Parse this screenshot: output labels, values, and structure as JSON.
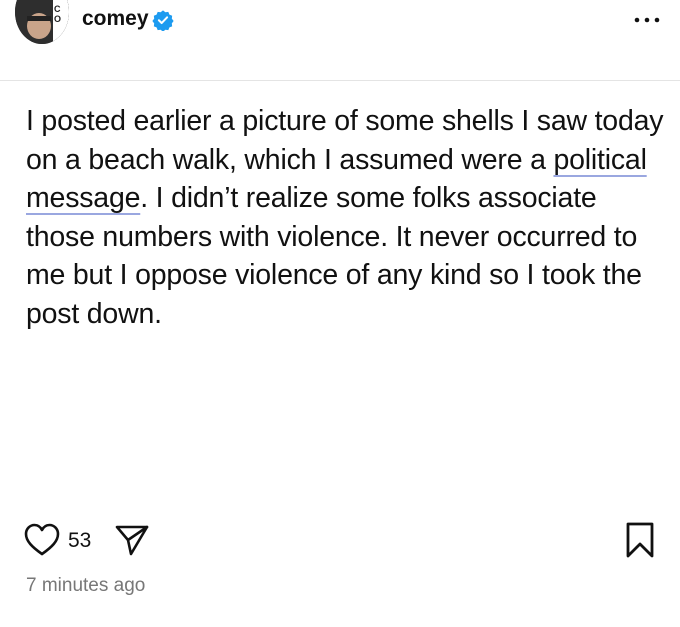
{
  "post": {
    "username": "comey",
    "verified": true,
    "avatar_badge": "CO",
    "text_before": "I posted earlier a picture of some shells I saw today on a beach walk, which I assumed were a ",
    "link_1": "political",
    "text_between": " ",
    "link_2": "message",
    "text_after": ". I didn’t realize some folks associate those numbers with violence. It never occurred to me but I oppose violence of any kind so I took the post down.",
    "like_count": "53",
    "timestamp": "7 minutes ago"
  },
  "icons": {
    "verified": "verified-badge-icon",
    "more": "more-options-icon",
    "like": "heart-icon",
    "share": "send-icon",
    "bookmark": "bookmark-icon"
  },
  "colors": {
    "verified_blue": "#1d9bf0",
    "text": "#111111",
    "muted": "#777777",
    "link_underline": "#9aa7e0"
  }
}
